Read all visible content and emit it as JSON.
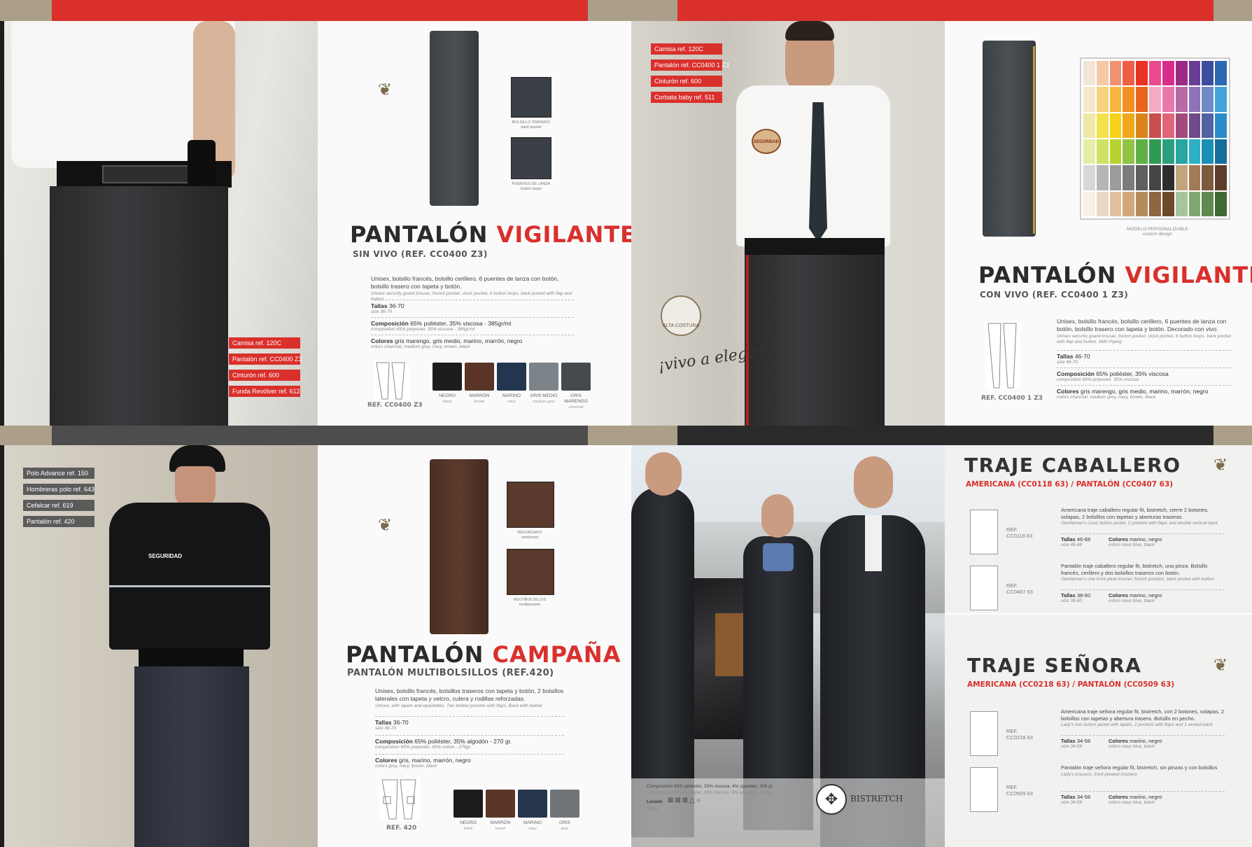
{
  "page1": {
    "tags": [
      "Camisa ref. 120C",
      "Pantalón ref. CC0400 Z3",
      "Cinturón ref. 600",
      "Funda Revólver ref. 612"
    ],
    "title_a": "PANTALÓN",
    "title_b": "VIGILANTE",
    "subtitle": "SIN VIVO  (REF. CC0400 Z3)",
    "desc": "Unisex, bolsillo francés, bolsillo cerillero, 6 puentes de lanza con botón, bolsillo trasero con tapeta y botón.",
    "desc_en": "Unisex security guard trouser, french pocket, clock pocket, 6 button loops, back pocket with flap and button",
    "sizes_label": "Tallas",
    "sizes": "36-70",
    "sizes_en": "size 36-70",
    "comp_label": "Composición",
    "comp": "65% poliéster, 35% viscosa - 385gr/ml",
    "comp_en": "composition 65% polyester, 35% viscose - 385gr/ml",
    "colors_label": "Colores",
    "colors": "gris marengo, gris medio, marino, marrón, negro",
    "colors_en": "colors charcoal, medium grey, navy, brown, black",
    "detail1": "BOLSILLO TRASERO",
    "detail1_en": "back pocket",
    "detail2": "PUENTES DE LANZA",
    "detail2_en": "button loops",
    "ref": "REF. CC0400 Z3",
    "swatches": [
      {
        "name": "NEGRO",
        "en": "black",
        "color": "#1d1d1f"
      },
      {
        "name": "MARRÓN",
        "en": "brown",
        "color": "#5a3527"
      },
      {
        "name": "MARINO",
        "en": "navy",
        "color": "#24364f"
      },
      {
        "name": "GRIS MEDIO",
        "en": "medium grey",
        "color": "#7c8389"
      },
      {
        "name": "GRIS MARENGO",
        "en": "charcoal",
        "color": "#454a4f"
      }
    ]
  },
  "page2": {
    "tags": [
      "Camisa ref. 120C",
      "Pantalón ref. CC0400 1 Z3",
      "Cinturón ref. 600",
      "Corbata baby ref. 511"
    ],
    "handwritten": "¡vivo a elegir!",
    "patch": "SEGURIDAD",
    "logo_text": "ALTA COSTURA",
    "title_a": "PANTALÓN",
    "title_b": "VIGILANTE",
    "subtitle": "CON VIVO  (REF. CC0400 1 Z3)",
    "custom": "MODELO PERSONALIZABLE",
    "custom_en": "custom design",
    "desc": "Unisex, bolsillo francés, bolsillo cerillero, 6 puentes de lanza con botón, bolsillo trasero con tapeta y botón. Decorado con vivo.",
    "desc_en": "Unisex security guard trouser, french pocket, clock pocket, 6 button loops, back pocket with flap and button. With Piping",
    "sizes_label": "Tallas",
    "sizes": "46-70",
    "sizes_en": "size 46-70",
    "comp_label": "Composición",
    "comp": "65% poliéster, 35% viscosa",
    "comp_en": "composition 65% polyester, 35% viscose",
    "colors_label": "Colores",
    "colors": "gris marengo, gris medio, marino, marrón, negro",
    "colors_en": "colors charcoal, medium grey, navy, brown, black",
    "ref": "REF. CC0400 1 Z3"
  },
  "page3": {
    "tags": [
      "Polo Advance ref. 150",
      "Hombreras polo ref. 643",
      "Cefalcar ref. 619",
      "Pantalón ref. 420"
    ],
    "polo_text": "SEGURIDAD",
    "title_a": "PANTALÓN",
    "title_b": "CAMPAÑA",
    "subtitle": "PANTALÓN MULTIBOLSILLOS (REF.420)",
    "desc": "Unisex, bolsillo francés, bolsillos traseros con tapeta y botón, 2 bolsillos laterales con tapeta y velcro, culera y rodillas reforzadas.",
    "desc_en": "Unisex, with lapels and epaulettes. Two bellow pockets with flaps. Back with bellow",
    "sizes_label": "Tallas",
    "sizes": "36-70",
    "sizes_en": "size 36-70",
    "comp_label": "Composición",
    "comp": "65% poliéster, 35% algodón - 270 gr.",
    "comp_en": "composition 65% polyester, 35% cotton - 270gr.",
    "colors_label": "Colores",
    "colors": "gris, marino, marrón, negro",
    "colors_en": "colors grey, navy, brown, black",
    "detail1": "REFORZADO",
    "detail1_en": "reinforced",
    "detail2": "MULTIBOLSILLOS",
    "detail2_en": "multipockets",
    "ref": "REF. 420",
    "swatches": [
      {
        "name": "NEGRO",
        "en": "black",
        "color": "#1c1c1e"
      },
      {
        "name": "MARRÓN",
        "en": "brown",
        "color": "#5b3628"
      },
      {
        "name": "MARINO",
        "en": "navy",
        "color": "#26374b"
      },
      {
        "name": "GRIS",
        "en": "grey",
        "color": "#6f7478"
      }
    ]
  },
  "page4": {
    "comp_line": "Composición 63% poliéster, 33% viscosa, 4% spandex, 305 gr.",
    "comp_en": "composition 63% polyester, 33% viscose, 4% spandex - 305gr.",
    "care_label": "Lavado",
    "care_en": "Wash",
    "bistretch": "BISTRETCH",
    "suit1_title": "TRAJE CABALLERO",
    "suit1_sub": "AMERICANA (CC0118 63) / PANTALÓN (CC0407 63)",
    "suit1_items": [
      {
        "ref_a": "REF.",
        "ref_b": "CC0118 63",
        "desc": "Americana traje caballero regular fit, bistretch, cierre 2 botones, solapas, 2 bolsillos con tapetas y aberturas traseras.",
        "desc_en": "Gentleman's Lisez button jacket, 2 pockets with flaps and double vertical back",
        "sizes": "46-68",
        "sizes_en": "size 46-68",
        "colors": "marino, negro",
        "colors_en": "colors navy blue, black"
      },
      {
        "ref_a": "REF.",
        "ref_b": "CC0407 63",
        "desc": "Pantalón traje caballero regular fit, bistretch, una pinza. Bolsillo francés, cerillero y dos bolsillos traseros con botón.",
        "desc_en": "Gentleman's one front pleat trouser, french pockets, back pocket with button",
        "sizes": "38-60",
        "sizes_en": "size 38-60",
        "colors": "marino, negro",
        "colors_en": "colors navy blue, black"
      }
    ],
    "suit2_title": "TRAJE SEÑORA",
    "suit2_sub": "AMERICANA (CC0218 63) / PANTALÓN (CC0509 63)",
    "suit2_items": [
      {
        "ref_a": "REF.",
        "ref_b": "CC0218 63",
        "desc": "Americana traje señora regular fit, bistretch, con 2 botones, solapas, 2 bolsillos con tapetas y abertura trasera. Bolsillo en pecho.",
        "desc_en": "Lady's two button jacket with lapels, 2 pockets with flaps and 1 vented back",
        "sizes": "34-58",
        "sizes_en": "size 34-58",
        "colors": "marino, negro",
        "colors_en": "colors navy blue, black"
      },
      {
        "ref_a": "REF.",
        "ref_b": "CC0509 63",
        "desc": "Pantalón traje señora regular fit, bistretch, sin pinzas y con bolsillos",
        "desc_en": "Lady's trousers, front pleated trousers",
        "sizes": "34-58",
        "sizes_en": "size 34-58",
        "colors": "marino, negro",
        "colors_en": "colors navy blue, black"
      }
    ],
    "labels": {
      "sizes": "Tallas",
      "colors": "Colores"
    }
  },
  "palette_colors": [
    "#f2e6d8",
    "#f5c9a8",
    "#f19173",
    "#ee5f45",
    "#e93323",
    "#ec4a8e",
    "#d72e8b",
    "#9b2c83",
    "#6a3e96",
    "#3e4e9f",
    "#2a6ab3",
    "#f3e9c8",
    "#f6d27e",
    "#f7b540",
    "#f48f22",
    "#e9651e",
    "#f4a9c6",
    "#e779aa",
    "#b86aa7",
    "#8d73b6",
    "#6f8bc5",
    "#41a3d9",
    "#efe8a7",
    "#f5e14c",
    "#f8d21a",
    "#f0a81a",
    "#d9841a",
    "#c94f4d",
    "#e0657a",
    "#a34a7c",
    "#6e4b8a",
    "#5462a3",
    "#2a8cc8",
    "#e6eea6",
    "#cfe266",
    "#b7d331",
    "#8fc444",
    "#5fb047",
    "#2f9a52",
    "#2c9f7f",
    "#27a6a3",
    "#2eb1c6",
    "#1c8fb5",
    "#176e9d",
    "#d7d7d7",
    "#b5b5b5",
    "#9b9b9b",
    "#7c7c7c",
    "#5f5f5f",
    "#454545",
    "#2d2d2d",
    "#c2a47f",
    "#a17b55",
    "#7d5a3c",
    "#5a3e2b",
    "#f7f0e5",
    "#e9d7c5",
    "#e0c09e",
    "#d3a779",
    "#b78a5c",
    "#8d673f",
    "#6b4a2c",
    "#a6c59a",
    "#7fa86f",
    "#5f8950",
    "#3f6a36"
  ]
}
